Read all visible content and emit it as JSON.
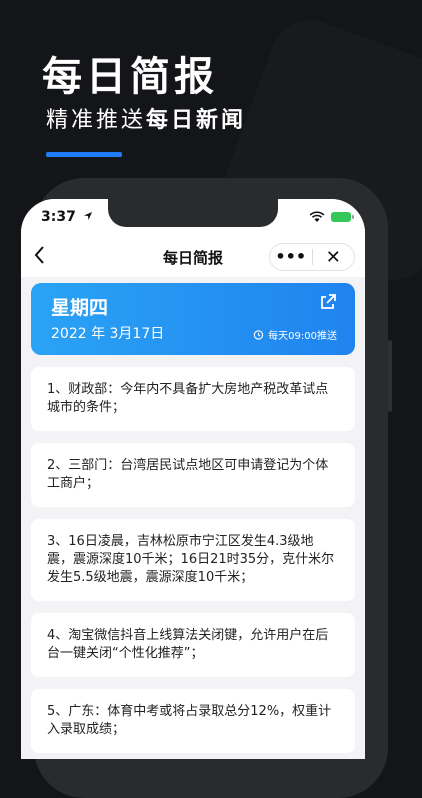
{
  "promo": {
    "title": "每日简报",
    "subtitle_plain": "精准推送",
    "subtitle_bold": "每日新闻"
  },
  "status_bar": {
    "time": "3:37"
  },
  "nav": {
    "title": "每日简报",
    "more_label": "•••",
    "close_label": "✕"
  },
  "header_card": {
    "weekday": "星期四",
    "date": "2022 年 3月17日",
    "push_time": "每天09:00推送"
  },
  "news": [
    "1、财政部：今年内不具备扩大房地产税改革试点城市的条件；",
    "2、三部门：台湾居民试点地区可申请登记为个体工商户；",
    "3、16日凌晨，吉林松原市宁江区发生4.3级地震，震源深度10千米；16日21时35分，克什米尔发生5.5级地震，震源深度10千米；",
    "4、淘宝微信抖音上线算法关闭键，允许用户在后台一键关闭“个性化推荐”；",
    "5、广东：体育中考或将占录取总分12%，权重计入录取成绩；"
  ],
  "colors": {
    "accent": "#1f7ef5",
    "card_gradient_start": "#2aa3f5",
    "card_gradient_end": "#1f83ef"
  }
}
